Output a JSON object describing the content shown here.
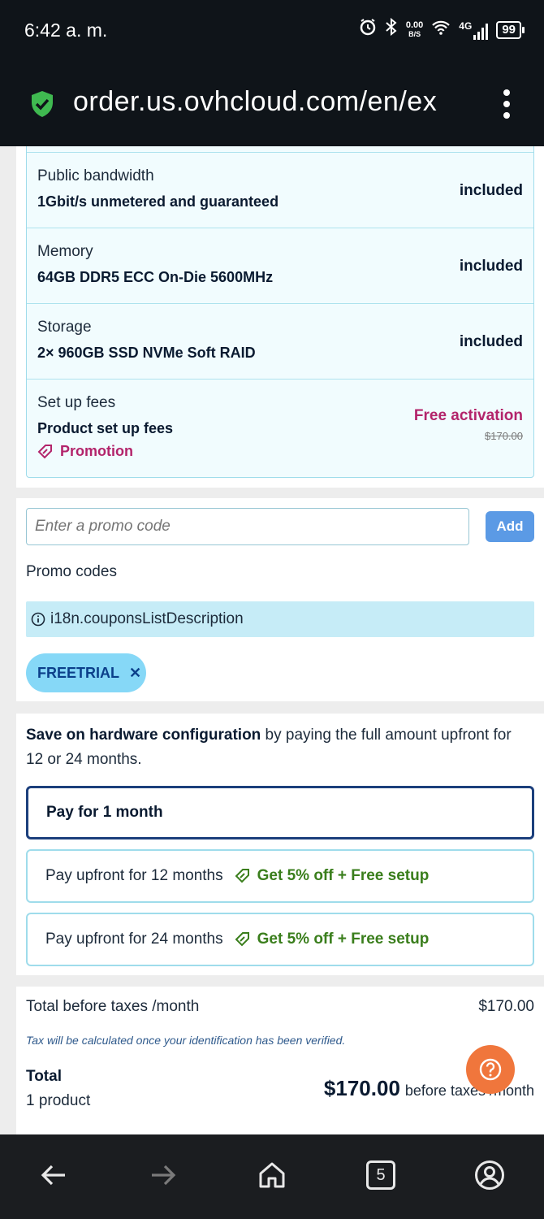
{
  "status_bar": {
    "time": "6:42 a. m.",
    "net_speed_value": "0.00",
    "net_speed_unit": "B/S",
    "network": "4G",
    "battery": "99"
  },
  "browser": {
    "url": "order.us.ovhcloud.com/en/ex"
  },
  "config": {
    "rows": [
      {
        "label": "Public bandwidth",
        "value": "1Gbit/s unmetered and guaranteed",
        "price": "included"
      },
      {
        "label": "Memory",
        "value": "64GB DDR5 ECC On-Die 5600MHz",
        "price": "included"
      },
      {
        "label": "Storage",
        "value": "2× 960GB SSD NVMe Soft RAID",
        "price": "included"
      },
      {
        "label": "Set up fees",
        "value": "Product set up fees",
        "price": "Free activation",
        "original_price": "$170.00",
        "promo_label": "Promotion"
      }
    ]
  },
  "promo": {
    "input_placeholder": "Enter a promo code",
    "add_label": "Add",
    "codes_title": "Promo codes",
    "info_text": "i18n.couponsListDescription",
    "applied_code": "FREETRIAL"
  },
  "billing": {
    "intro_bold": "Save on hardware configuration",
    "intro_rest": " by paying the full amount upfront for 12 or 24 months.",
    "options": [
      {
        "label": "Pay for 1 month",
        "deal": ""
      },
      {
        "label": "Pay upfront for 12 months",
        "deal": "Get 5% off + Free setup"
      },
      {
        "label": "Pay upfront for 24 months",
        "deal": "Get 5% off + Free setup"
      }
    ]
  },
  "totals": {
    "before_taxes_label": "Total before taxes /month",
    "before_taxes_value": "$170.00",
    "tax_note": "Tax will be calculated once your identification has been verified.",
    "total_label": "Total",
    "product_count": "1 product",
    "total_amount": "$170.00",
    "total_suffix": "before taxes /month"
  },
  "bottom_nav": {
    "tab_count": "5"
  }
}
